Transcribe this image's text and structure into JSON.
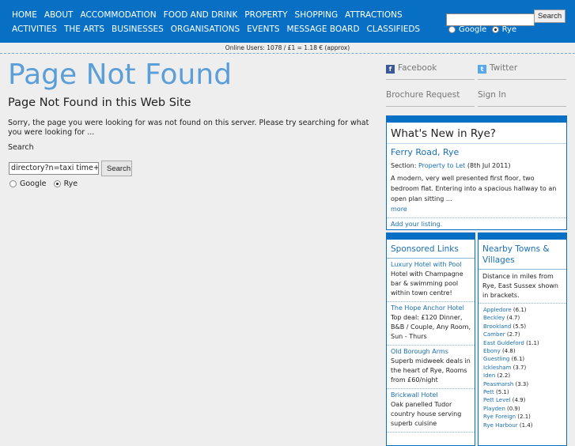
{
  "nav": {
    "row1": [
      "HOME",
      "ABOUT",
      "ACCOMMODATION",
      "FOOD AND DRINK",
      "PROPERTY",
      "SHOPPING",
      "ATTRACTIONS"
    ],
    "row2": [
      "ACTIVITIES",
      "THE ARTS",
      "BUSINESSES",
      "ORGANISATIONS",
      "EVENTS",
      "MESSAGE BOARD",
      "CLASSIFIEDS"
    ]
  },
  "top_search": {
    "button": "Search",
    "opt_google": "Google",
    "opt_rye": "Rye"
  },
  "online": "Online Users: 1078 / £1 = 1.18 € (approx)",
  "page": {
    "title": "Page Not Found",
    "subtitle": "Page Not Found in this Web Site",
    "message": "Sorry, the page you were looking for was not found on this server. Please try searching for what you were looking for ...",
    "search_label": "Search",
    "search_value": "directory?n=taxi time+ltd",
    "search_button": "Search",
    "opt_google": "Google",
    "opt_rye": "Rye"
  },
  "side": {
    "facebook": "Facebook",
    "twitter": "Twitter",
    "brochure": "Brochure Request",
    "signin": "Sign In"
  },
  "whats_new": {
    "title": "What's New in Rye?",
    "item_title": "Ferry Road, Rye",
    "section_prefix": "Section: ",
    "section": "Property to Let",
    "date": " (8th Jul 2011)",
    "desc": "A modern, very well presented first floor, two bedroom flat. Entering into a spacious hallway to an open plan sitting ...",
    "more": "more",
    "add": "Add your listing."
  },
  "sponsored": {
    "title": "Sponsored Links",
    "items": [
      {
        "name": "Luxury Hotel with Pool",
        "desc": "Hotel with Champagne bar & swimming pool within town centre!"
      },
      {
        "name": "The Hope Anchor Hotel",
        "desc": "Top deal: £120 Dinner, B&B / Couple, Any Room, Sun - Thurs"
      },
      {
        "name": "Old Borough Arms",
        "desc": "Superb midweek deals in the heart of Rye, Rooms from £60/night"
      },
      {
        "name": "Brickwall Hotel",
        "desc": "Oak panelled Tudor country house serving superb cuisine"
      }
    ]
  },
  "nearby": {
    "title": "Nearby Towns & Villages",
    "intro": "Distance in miles from Rye, East Sussex shown in brackets.",
    "towns": [
      {
        "name": "Appledore",
        "dist": " (6.1)"
      },
      {
        "name": "Beckley",
        "dist": " (4.7)"
      },
      {
        "name": "Brookland",
        "dist": " (5.5)"
      },
      {
        "name": "Camber",
        "dist": " (2.7)"
      },
      {
        "name": "East Guldeford",
        "dist": " (1.1)"
      },
      {
        "name": "Ebony",
        "dist": " (4.8)"
      },
      {
        "name": "Guestling",
        "dist": " (6.1)"
      },
      {
        "name": "Icklesham",
        "dist": " (3.7)"
      },
      {
        "name": "Iden",
        "dist": " (2.2)"
      },
      {
        "name": "Peasmarsh",
        "dist": " (3.3)"
      },
      {
        "name": "Pett",
        "dist": " (5.1)"
      },
      {
        "name": "Pett Level",
        "dist": " (4.9)"
      },
      {
        "name": "Playden",
        "dist": " (0.9)"
      },
      {
        "name": "Rye Foreign",
        "dist": " (2.1)"
      },
      {
        "name": "Rye Harbour",
        "dist": " (1.4)"
      }
    ]
  },
  "colors": {
    "brand": "#0770c4",
    "link": "#1a6fb5",
    "title": "#5c9fd8"
  }
}
